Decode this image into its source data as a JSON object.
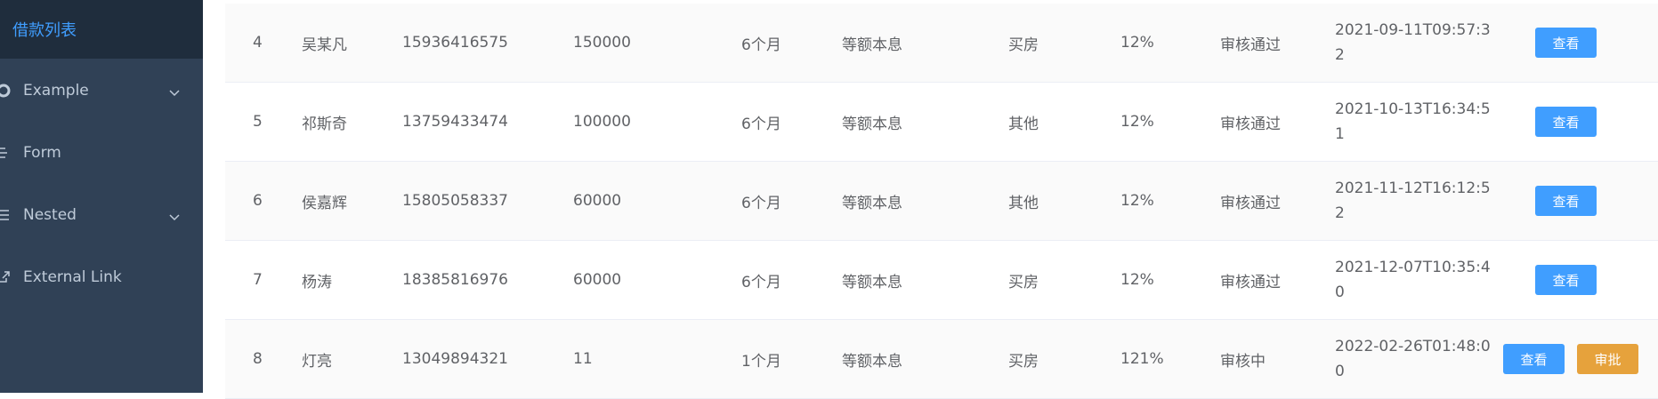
{
  "sidebar": {
    "active_item": "借款列表",
    "items": [
      {
        "label": "Example",
        "icon": "example-icon",
        "has_submenu": true
      },
      {
        "label": "Form",
        "icon": "form-icon",
        "has_submenu": false
      },
      {
        "label": "Nested",
        "icon": "nested-icon",
        "has_submenu": true
      },
      {
        "label": "External Link",
        "icon": "external-link-icon",
        "has_submenu": false
      }
    ]
  },
  "table": {
    "rows": [
      {
        "id": "4",
        "name": "吴某凡",
        "phone": "15936416575",
        "amount": "150000",
        "term": "6个月",
        "method": "等额本息",
        "purpose": "买房",
        "rate": "12%",
        "status": "审核通过",
        "time": "2021-09-11T09:57:32",
        "actions": [
          "查看"
        ]
      },
      {
        "id": "5",
        "name": "祁斯奇",
        "phone": "13759433474",
        "amount": "100000",
        "term": "6个月",
        "method": "等额本息",
        "purpose": "其他",
        "rate": "12%",
        "status": "审核通过",
        "time": "2021-10-13T16:34:51",
        "actions": [
          "查看"
        ]
      },
      {
        "id": "6",
        "name": "侯嘉辉",
        "phone": "15805058337",
        "amount": "60000",
        "term": "6个月",
        "method": "等额本息",
        "purpose": "其他",
        "rate": "12%",
        "status": "审核通过",
        "time": "2021-11-12T16:12:52",
        "actions": [
          "查看"
        ]
      },
      {
        "id": "7",
        "name": "杨涛",
        "phone": "18385816976",
        "amount": "60000",
        "term": "6个月",
        "method": "等额本息",
        "purpose": "买房",
        "rate": "12%",
        "status": "审核通过",
        "time": "2021-12-07T10:35:40",
        "actions": [
          "查看"
        ]
      },
      {
        "id": "8",
        "name": "灯亮",
        "phone": "13049894321",
        "amount": "11",
        "term": "1个月",
        "method": "等额本息",
        "purpose": "买房",
        "rate": "121%",
        "status": "审核中",
        "time": "2022-02-26T01:48:00",
        "actions": [
          "查看",
          "审批"
        ]
      }
    ]
  },
  "colors": {
    "sidebar_bg": "#304156",
    "active_bg": "#1f2d3d",
    "active_text": "#409eff",
    "primary": "#409eff",
    "warning": "#e6a23c"
  }
}
